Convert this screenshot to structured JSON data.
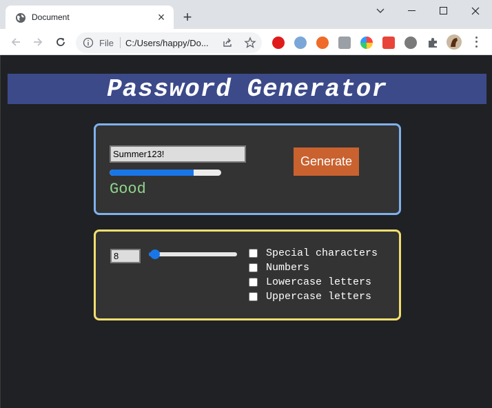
{
  "browser": {
    "tab_title": "Document",
    "file_label": "File",
    "url": "C:/Users/happy/Do...",
    "colors": {
      "tabstrip": "#dee1e6",
      "toolbar": "#ffffff"
    },
    "icons": [
      "globe-icon",
      "close-icon",
      "plus-icon",
      "chevron-down-icon",
      "minimize-icon",
      "maximize-icon",
      "window-close-icon",
      "back-icon",
      "forward-icon",
      "reload-icon",
      "info-icon",
      "share-icon",
      "star-icon",
      "puzzle-icon",
      "profile-avatar",
      "menu-dots-icon"
    ]
  },
  "page": {
    "title": "Password Generator",
    "password": {
      "value": "Summer123!",
      "strength_fraction": 0.75,
      "strength_label": "Good"
    },
    "generate_button": "Generate",
    "length": {
      "value": "8",
      "slider_fraction": 0.0
    },
    "options": [
      {
        "label": "Special characters",
        "checked": false
      },
      {
        "label": "Numbers",
        "checked": false
      },
      {
        "label": "Lowercase letters",
        "checked": false
      },
      {
        "label": "Uppercase letters",
        "checked": false
      }
    ],
    "colors": {
      "background": "#202124",
      "header": "#3c4a8a",
      "card_top_border": "#7fb1ec",
      "card_bottom_border": "#f3df6f",
      "accent": "#1976e8",
      "strength_text": "#8fd48a",
      "generate_button": "#c9622f"
    }
  }
}
